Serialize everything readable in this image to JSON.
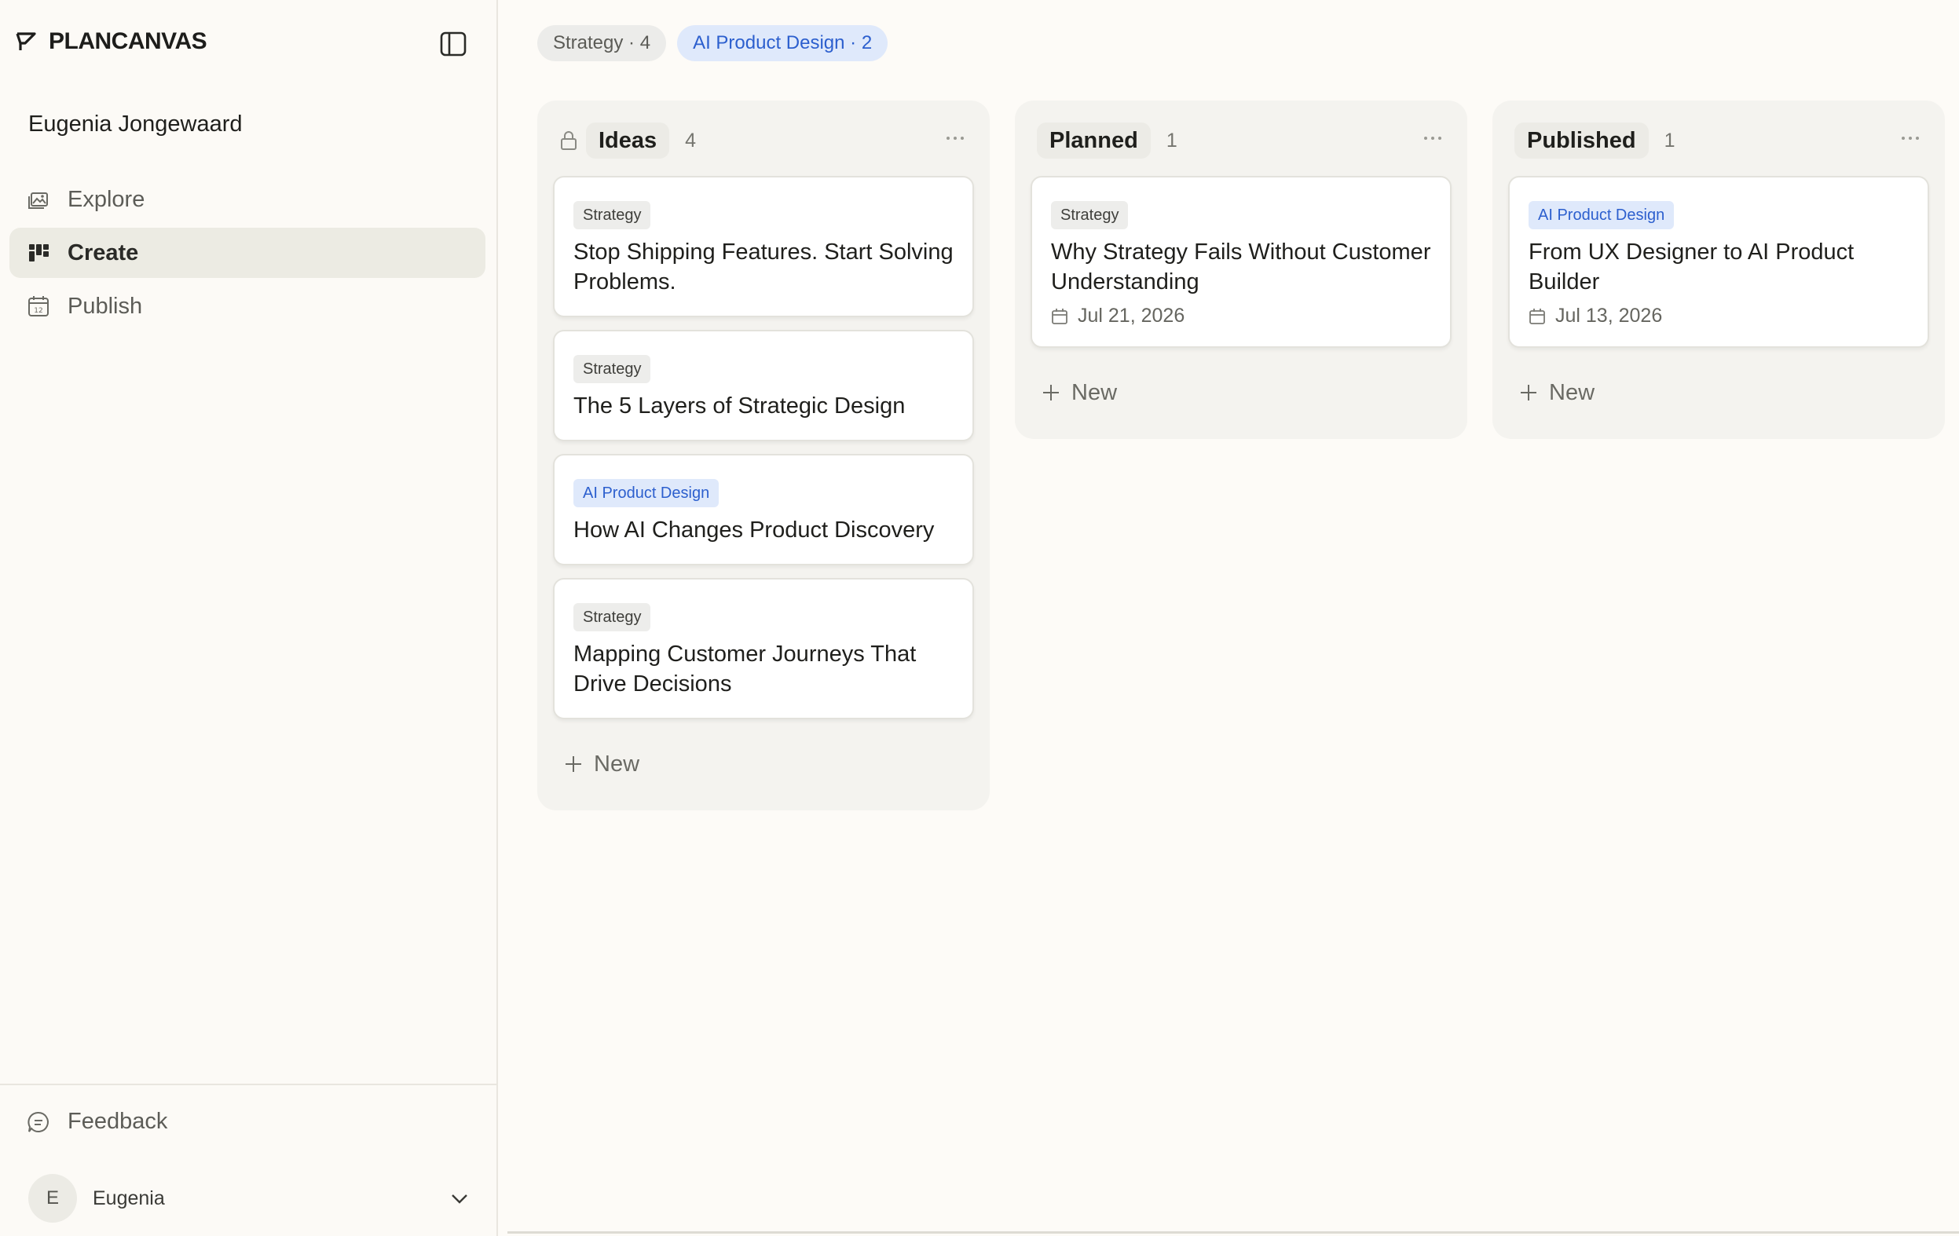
{
  "app": {
    "name": "PLANCANVAS"
  },
  "workspace": {
    "name": "Eugenia Jongewaard"
  },
  "nav": [
    {
      "label": "Explore",
      "icon": "gallery-icon",
      "active": false
    },
    {
      "label": "Create",
      "icon": "kanban-icon",
      "active": true
    },
    {
      "label": "Publish",
      "icon": "calendar-icon",
      "active": false
    }
  ],
  "footer": {
    "feedback_label": "Feedback"
  },
  "user": {
    "initial": "E",
    "name": "Eugenia"
  },
  "filters": [
    {
      "label": "Strategy · 4",
      "variant": "gray"
    },
    {
      "label": "AI Product Design · 2",
      "variant": "blue"
    }
  ],
  "columns": [
    {
      "title": "Ideas",
      "count": "4",
      "locked": true,
      "new_label": "New",
      "cards": [
        {
          "tag": "Strategy",
          "tag_variant": "gray",
          "title": "Stop Shipping Features. Start Solving Problems."
        },
        {
          "tag": "Strategy",
          "tag_variant": "gray",
          "title": "The 5 Layers of Strategic Design"
        },
        {
          "tag": "AI Product Design",
          "tag_variant": "blue",
          "title": "How AI Changes Product Discovery"
        },
        {
          "tag": "Strategy",
          "tag_variant": "gray",
          "title": "Mapping Customer Journeys That Drive Decisions"
        }
      ]
    },
    {
      "title": "Planned",
      "count": "1",
      "locked": false,
      "new_label": "New",
      "cards": [
        {
          "tag": "Strategy",
          "tag_variant": "gray",
          "title": "Why Strategy Fails Without Customer Understanding",
          "date": "Jul 21, 2026"
        }
      ]
    },
    {
      "title": "Published",
      "count": "1",
      "locked": false,
      "new_label": "New",
      "cards": [
        {
          "tag": "AI Product Design",
          "tag_variant": "blue",
          "title": "From UX Designer to AI Product Builder",
          "date": "Jul 13, 2026"
        }
      ]
    }
  ],
  "colors": {
    "accent_blue": "#2c5fce",
    "chip_blue_bg": "#dfe9fb",
    "page_bg": "#fdfbf7",
    "column_bg": "#f4f3ef"
  }
}
